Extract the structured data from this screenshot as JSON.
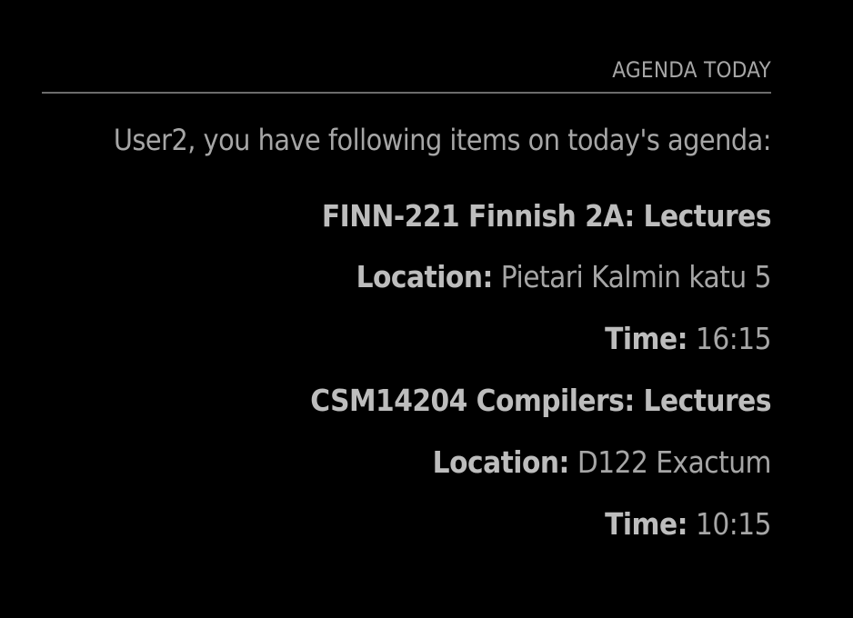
{
  "module": {
    "header": "AGENDA TODAY",
    "intro": "User2, you have following items on today's agenda:"
  },
  "labels": {
    "location": "Location:",
    "time": "Time:"
  },
  "events": [
    {
      "title": "FINN-221 Finnish 2A: Lectures",
      "location": "Pietari Kalmin katu 5",
      "time": "16:15"
    },
    {
      "title": "CSM14204 Compilers: Lectures",
      "location": "D122 Exactum",
      "time": "10:15"
    }
  ],
  "colors": {
    "background": "#000000",
    "text": "#a6a6a6",
    "bold_text": "#bdbdbd",
    "divider": "#6c6c6c"
  }
}
